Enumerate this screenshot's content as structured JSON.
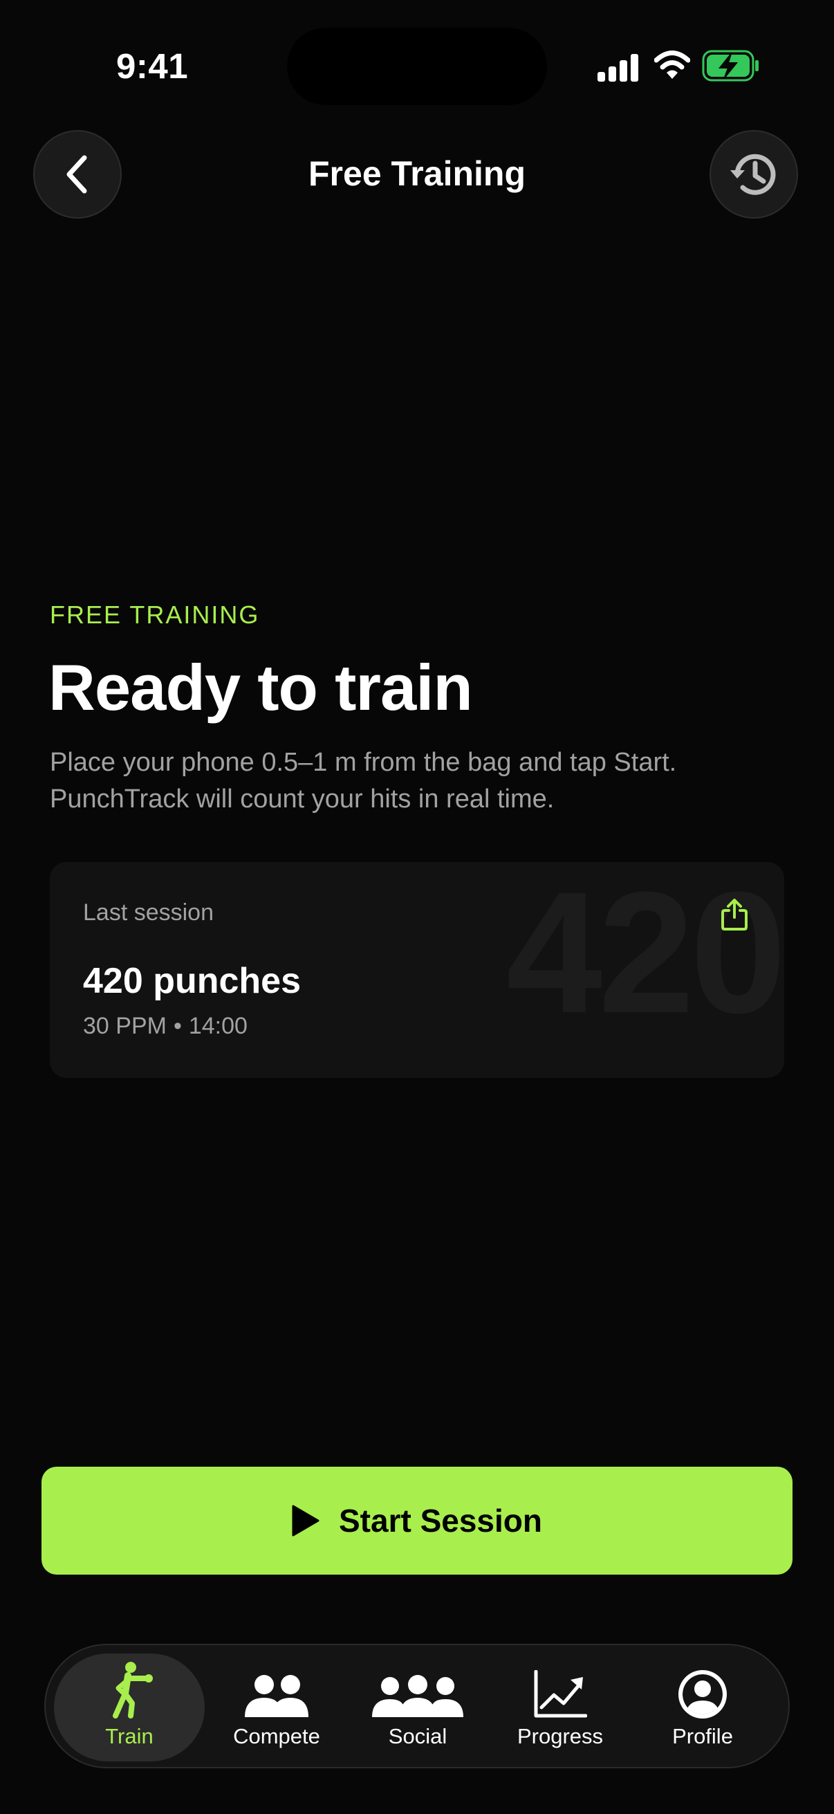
{
  "status_bar": {
    "time": "9:41"
  },
  "header": {
    "title": "Free Training",
    "back_icon": "chevron-left-icon",
    "history_icon": "history-clock-icon"
  },
  "hero": {
    "eyebrow": "FREE TRAINING",
    "headline": "Ready to train",
    "description": "Place your phone 0.5–1 m from the bag and tap Start. PunchTrack will count your hits in real time."
  },
  "last_session": {
    "label": "Last session",
    "title": "420 punches",
    "ppm": "30 PPM",
    "separator": "•",
    "duration": "14:00",
    "watermark": "420",
    "share_icon": "share-icon"
  },
  "start_button": {
    "label": "Start Session",
    "icon": "play-icon"
  },
  "tabs": [
    {
      "label": "Train",
      "icon": "boxer-icon",
      "active": true
    },
    {
      "label": "Compete",
      "icon": "two-users-icon",
      "active": false
    },
    {
      "label": "Social",
      "icon": "three-users-icon",
      "active": false
    },
    {
      "label": "Progress",
      "icon": "chart-trend-icon",
      "active": false
    },
    {
      "label": "Profile",
      "icon": "user-circle-icon",
      "active": false
    }
  ],
  "colors": {
    "accent": "#a8ee4d",
    "background": "#070707",
    "card": "#121212",
    "battery": "#34c759"
  }
}
